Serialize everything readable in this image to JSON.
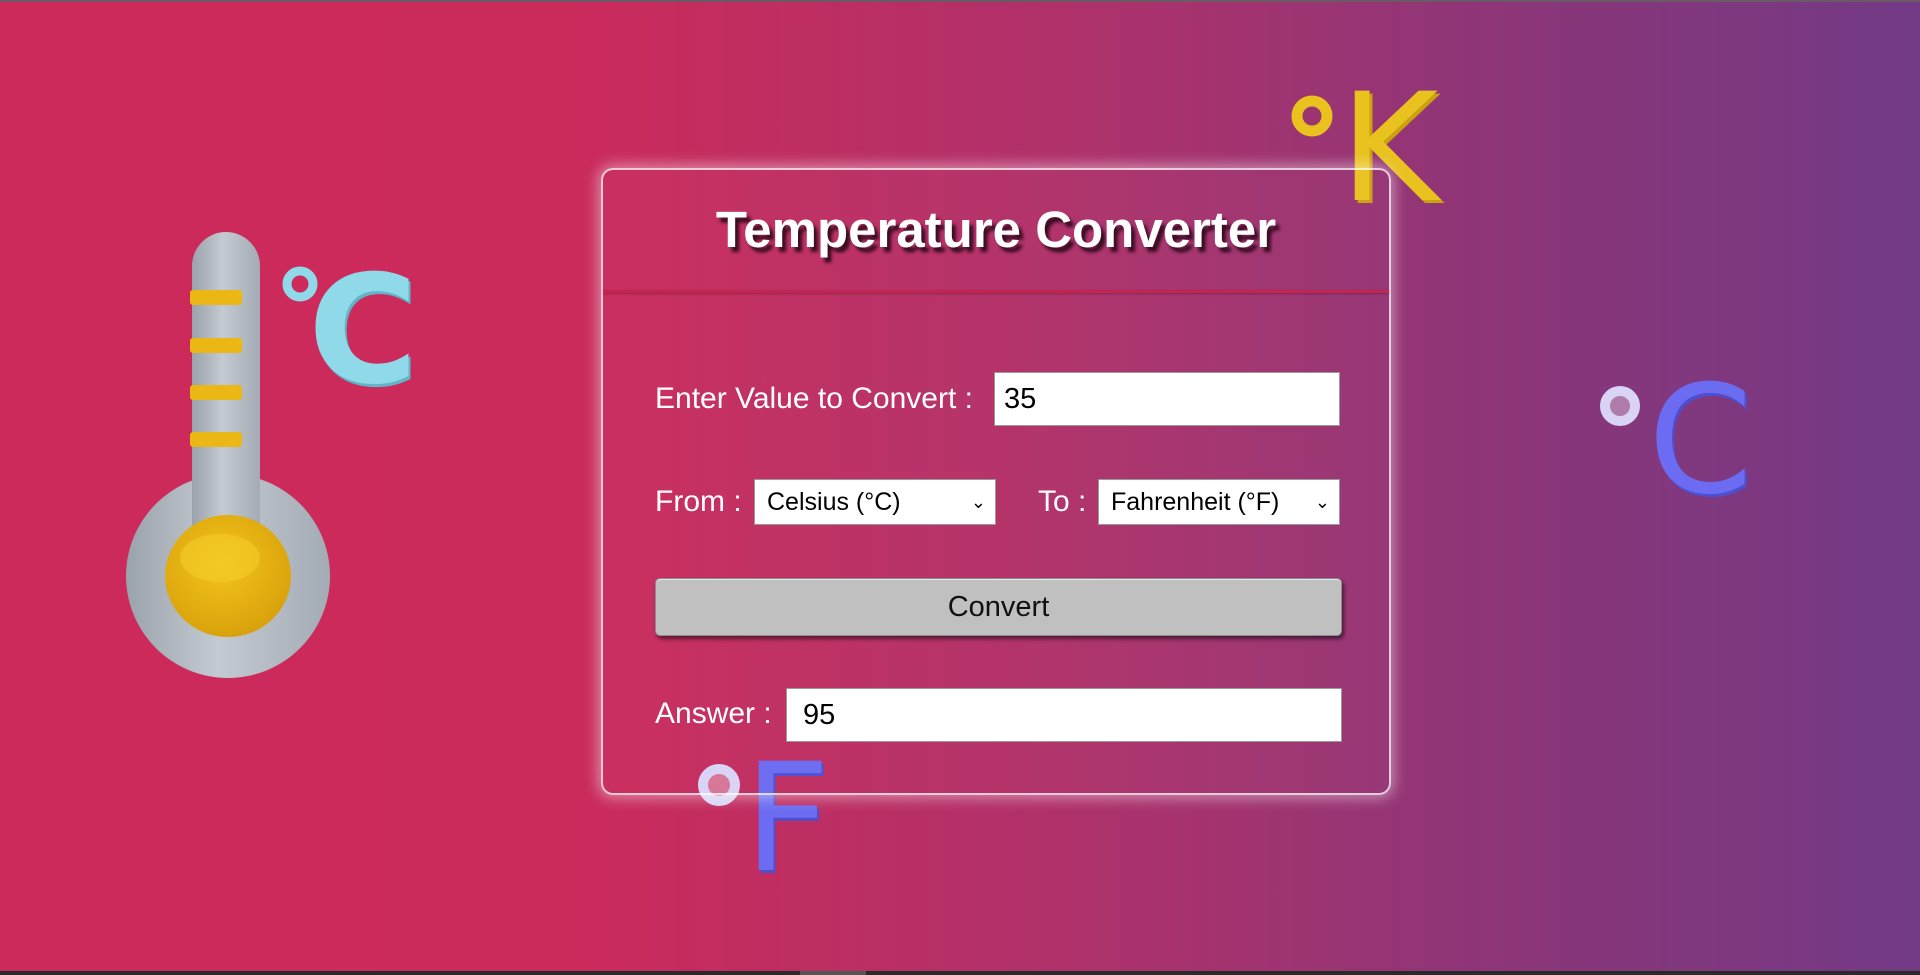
{
  "app": {
    "title": "Temperature Converter"
  },
  "form": {
    "value_label": "Enter Value to Convert :",
    "value_input": "35",
    "from_label": "From :",
    "from_selected": "Celsius (°C)",
    "to_label": "To :",
    "to_selected": "Fahrenheit (°F)",
    "convert_label": "Convert",
    "answer_label": "Answer :",
    "answer_value": "95"
  },
  "decorations": {
    "kelvin_symbol": "K",
    "celsius_symbol_left": "C",
    "celsius_symbol_right": "C",
    "fahrenheit_symbol": "F",
    "icons": [
      "thermometer-icon",
      "celsius-icon",
      "kelvin-icon",
      "fahrenheit-icon"
    ]
  },
  "colors": {
    "background_start": "#cc2a5a",
    "background_end": "#733a86",
    "kelvin_yellow": "#e9c21f",
    "celsius_light_blue": "#8fd9e8",
    "outline_purple": "#6b6cf2",
    "thermometer_gray": "#b9c0c8",
    "thermometer_yellow": "#eab714",
    "button_gray": "#c0c0c0"
  }
}
